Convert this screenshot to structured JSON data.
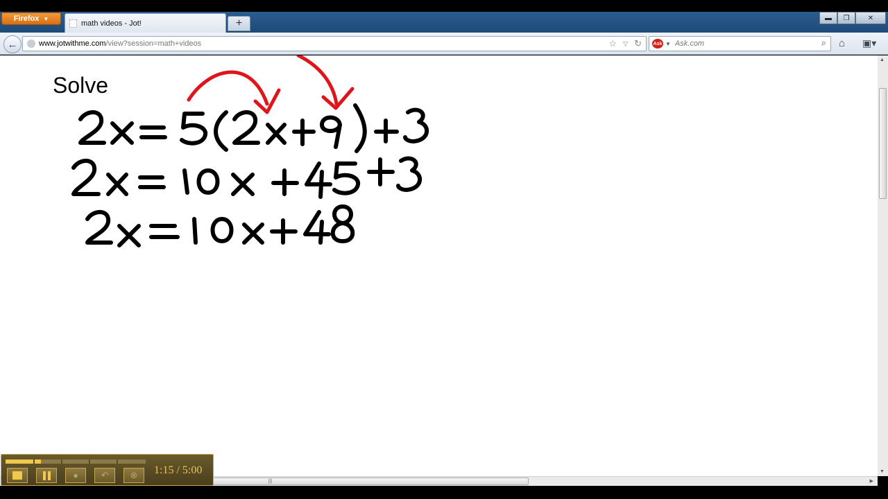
{
  "browser": {
    "menu_button": "Firefox",
    "tab_title": "math videos - Jot!",
    "new_tab_label": "+",
    "url_host": "www.jotwithme.com",
    "url_path": "/view?session=math+videos",
    "search_placeholder": "Ask.com",
    "search_engine_logo": "Ask"
  },
  "page": {
    "heading": "Solve",
    "ink_color": "#000000",
    "annotation_color": "#e0141b"
  },
  "recorder": {
    "time": "1:15 / 5:00",
    "progress": 0.25,
    "buttons": [
      "stop-icon",
      "pause-icon",
      "microphone-icon",
      "undo-icon",
      "cancel-icon"
    ]
  },
  "icons": {
    "back": "back-arrow-icon",
    "star": "bookmark-star-icon",
    "reload": "reload-icon",
    "home": "home-icon",
    "search": "search-icon"
  }
}
